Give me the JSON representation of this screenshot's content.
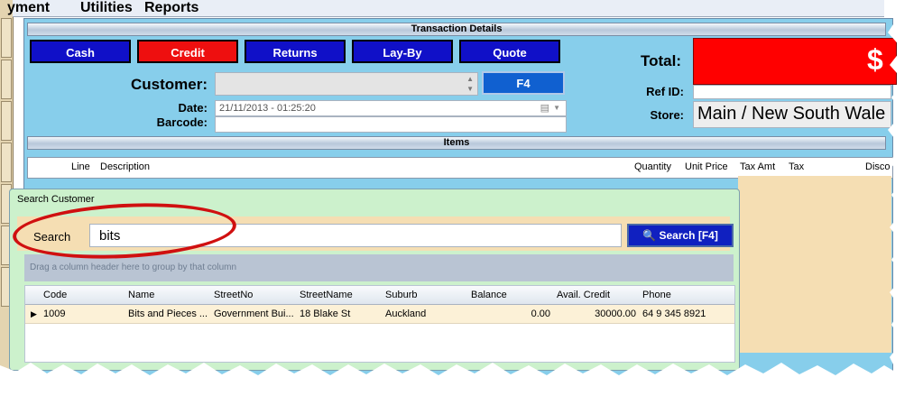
{
  "menu": [
    "yment",
    "Utilities",
    "Reports"
  ],
  "transaction": {
    "header": "Transaction Details",
    "buttons": [
      "Cash",
      "Credit",
      "Returns",
      "Lay-By",
      "Quote"
    ],
    "customer_label": "Customer:",
    "f4_label": "F4",
    "date_label": "Date:",
    "date_value": "21/11/2013 - 01:25:20",
    "barcode_label": "Barcode:",
    "total_label": "Total:",
    "total_value": "$",
    "refid_label": "Ref ID:",
    "store_label": "Store:",
    "store_value": "Main / New South Wale"
  },
  "items": {
    "header": "Items",
    "columns": [
      "Line",
      "Description",
      "Quantity",
      "Unit Price",
      "Tax Amt",
      "Tax",
      "Disco"
    ]
  },
  "search_dialog": {
    "title": "Search Customer",
    "search_label": "Search",
    "search_value": "bits",
    "search_button": "Search [F4]",
    "group_hint": "Drag a column header here to group by that column",
    "columns": [
      "Code",
      "Name",
      "StreetNo",
      "StreetName",
      "Suburb",
      "Balance",
      "Avail. Credit",
      "Phone"
    ],
    "rows": [
      [
        "1009",
        "Bits and Pieces ...",
        "Government Bui...",
        "18 Blake St",
        "Auckland",
        "0.00",
        "30000.00",
        "64 9 345 8921"
      ]
    ]
  },
  "colors": {
    "panel": "#87ceeb",
    "dialog": "#ccf1cc",
    "tan": "#f5deb3",
    "button_blue": "#1010c8",
    "button_red": "#ee0f0f",
    "total_red": "#ff0000",
    "annotation": "#d01010"
  },
  "icons": [
    "search-icon",
    "dropdown-arrow-icon",
    "calendar-icon",
    "row-indicator-icon"
  ]
}
